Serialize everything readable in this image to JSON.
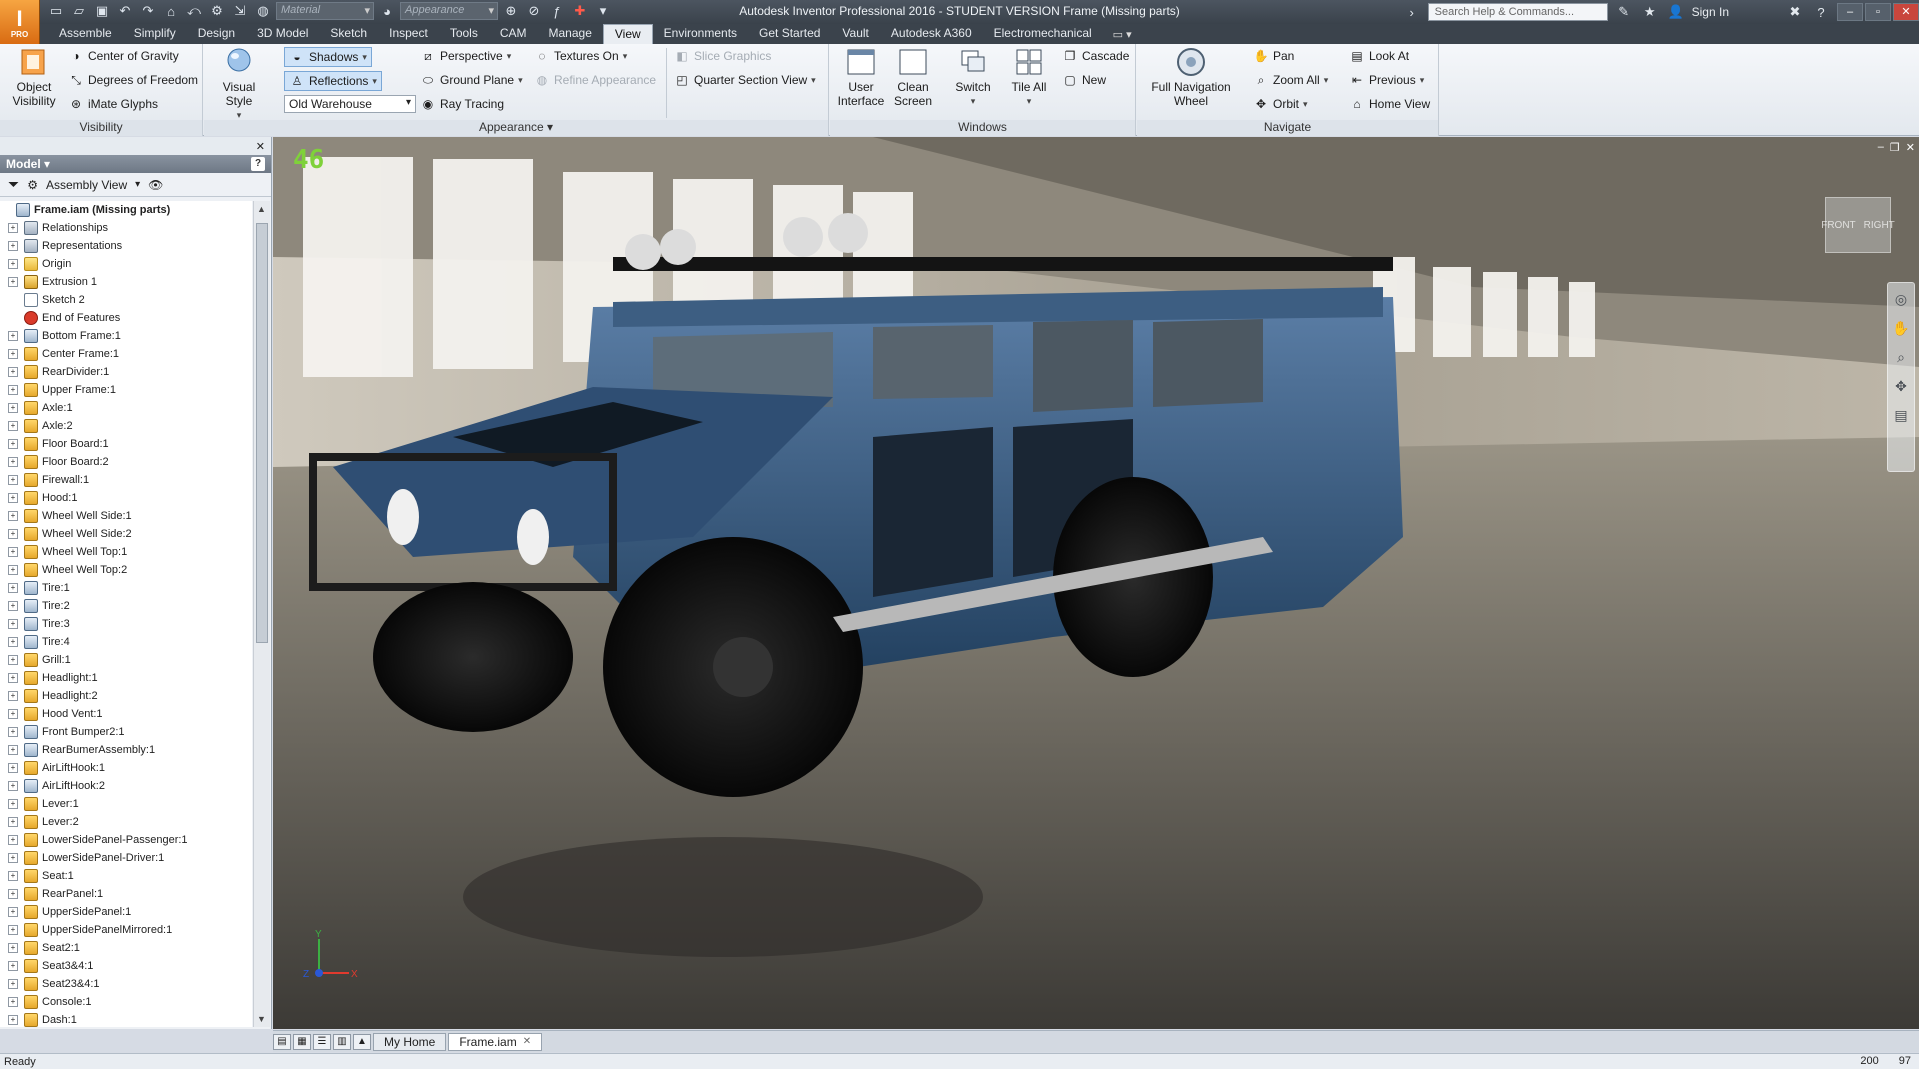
{
  "app": {
    "window_title": "Autodesk Inventor Professional 2016 - STUDENT VERSION    Frame (Missing parts)",
    "app_letter": "I",
    "app_sub": "PRO",
    "search_placeholder": "Search Help & Commands...",
    "sign_in": "Sign In",
    "material_placeholder": "Material",
    "appearance_placeholder": "Appearance"
  },
  "tabs": [
    "Assemble",
    "Simplify",
    "Design",
    "3D Model",
    "Sketch",
    "Inspect",
    "Tools",
    "CAM",
    "Manage",
    "View",
    "Environments",
    "Get Started",
    "Vault",
    "Autodesk A360",
    "Electromechanical"
  ],
  "active_tab": "View",
  "ribbon": {
    "visibility": {
      "title": "Visibility",
      "object_visibility": "Object\nVisibility",
      "center_of_gravity": "Center of Gravity",
      "degrees_of_freedom": "Degrees of Freedom",
      "imate_glyphs": "iMate Glyphs"
    },
    "appearance": {
      "title": "Appearance",
      "visual_style": "Visual Style",
      "shadows": "Shadows",
      "reflections": "Reflections",
      "lighting_style": "Old Warehouse",
      "perspective": "Perspective",
      "ground_plane": "Ground Plane",
      "ray_tracing": "Ray Tracing",
      "textures_on": "Textures On",
      "refine_appearance": "Refine Appearance",
      "slice_graphics": "Slice Graphics",
      "quarter_section_view": "Quarter Section View"
    },
    "windows": {
      "title": "Windows",
      "user_interface": "User\nInterface",
      "clean_screen": "Clean\nScreen",
      "switch": "Switch",
      "tile_all": "Tile All",
      "cascade": "Cascade",
      "new": "New"
    },
    "navigate": {
      "title": "Navigate",
      "full_nav_wheel": "Full Navigation\nWheel",
      "pan": "Pan",
      "zoom_all": "Zoom All",
      "orbit": "Orbit",
      "look_at": "Look At",
      "previous": "Previous",
      "home_view": "Home View"
    }
  },
  "browser": {
    "title": "Model",
    "view_mode": "Assembly View",
    "root": "Frame.iam (Missing parts)",
    "items": [
      {
        "label": "Relationships",
        "icon": "rel"
      },
      {
        "label": "Representations",
        "icon": "rel"
      },
      {
        "label": "Origin",
        "icon": "folder"
      },
      {
        "label": "Extrusion 1",
        "icon": "extrude"
      },
      {
        "label": "Sketch 2",
        "icon": "sketch"
      },
      {
        "label": "End of Features",
        "icon": "end"
      },
      {
        "label": "Bottom Frame:1",
        "icon": "asm"
      },
      {
        "label": "Center Frame:1",
        "icon": "part"
      },
      {
        "label": "RearDivider:1",
        "icon": "part"
      },
      {
        "label": "Upper Frame:1",
        "icon": "part"
      },
      {
        "label": "Axle:1",
        "icon": "part"
      },
      {
        "label": "Axle:2",
        "icon": "part"
      },
      {
        "label": "Floor Board:1",
        "icon": "part"
      },
      {
        "label": "Floor Board:2",
        "icon": "part"
      },
      {
        "label": "Firewall:1",
        "icon": "part"
      },
      {
        "label": "Hood:1",
        "icon": "part"
      },
      {
        "label": "Wheel Well Side:1",
        "icon": "part"
      },
      {
        "label": "Wheel Well Side:2",
        "icon": "part"
      },
      {
        "label": "Wheel Well Top:1",
        "icon": "part"
      },
      {
        "label": "Wheel Well Top:2",
        "icon": "part"
      },
      {
        "label": "Tire:1",
        "icon": "asm"
      },
      {
        "label": "Tire:2",
        "icon": "asm"
      },
      {
        "label": "Tire:3",
        "icon": "asm"
      },
      {
        "label": "Tire:4",
        "icon": "asm"
      },
      {
        "label": "Grill:1",
        "icon": "part"
      },
      {
        "label": "Headlight:1",
        "icon": "part"
      },
      {
        "label": "Headlight:2",
        "icon": "part"
      },
      {
        "label": "Hood Vent:1",
        "icon": "part"
      },
      {
        "label": "Front Bumper2:1",
        "icon": "asm"
      },
      {
        "label": "RearBumerAssembly:1",
        "icon": "asm"
      },
      {
        "label": "AirLiftHook:1",
        "icon": "part"
      },
      {
        "label": "AirLiftHook:2",
        "icon": "asm"
      },
      {
        "label": "Lever:1",
        "icon": "part"
      },
      {
        "label": "Lever:2",
        "icon": "part"
      },
      {
        "label": "LowerSidePanel-Passenger:1",
        "icon": "part"
      },
      {
        "label": "LowerSidePanel-Driver:1",
        "icon": "part"
      },
      {
        "label": "Seat:1",
        "icon": "part"
      },
      {
        "label": "RearPanel:1",
        "icon": "part"
      },
      {
        "label": "UpperSidePanel:1",
        "icon": "part"
      },
      {
        "label": "UpperSidePanelMirrored:1",
        "icon": "part"
      },
      {
        "label": "Seat2:1",
        "icon": "part"
      },
      {
        "label": "Seat3&4:1",
        "icon": "part"
      },
      {
        "label": "Seat23&4:1",
        "icon": "part"
      },
      {
        "label": "Console:1",
        "icon": "part"
      },
      {
        "label": "Dash:1",
        "icon": "part"
      }
    ]
  },
  "viewport": {
    "fps": "46",
    "viewcube_front": "FRONT",
    "viewcube_right": "RIGHT",
    "axis_x": "X",
    "axis_y": "Y",
    "axis_z": "Z"
  },
  "doc_tabs": {
    "home": "My Home",
    "doc": "Frame.iam"
  },
  "status": {
    "left": "Ready",
    "count1": "200",
    "count2": "97"
  }
}
